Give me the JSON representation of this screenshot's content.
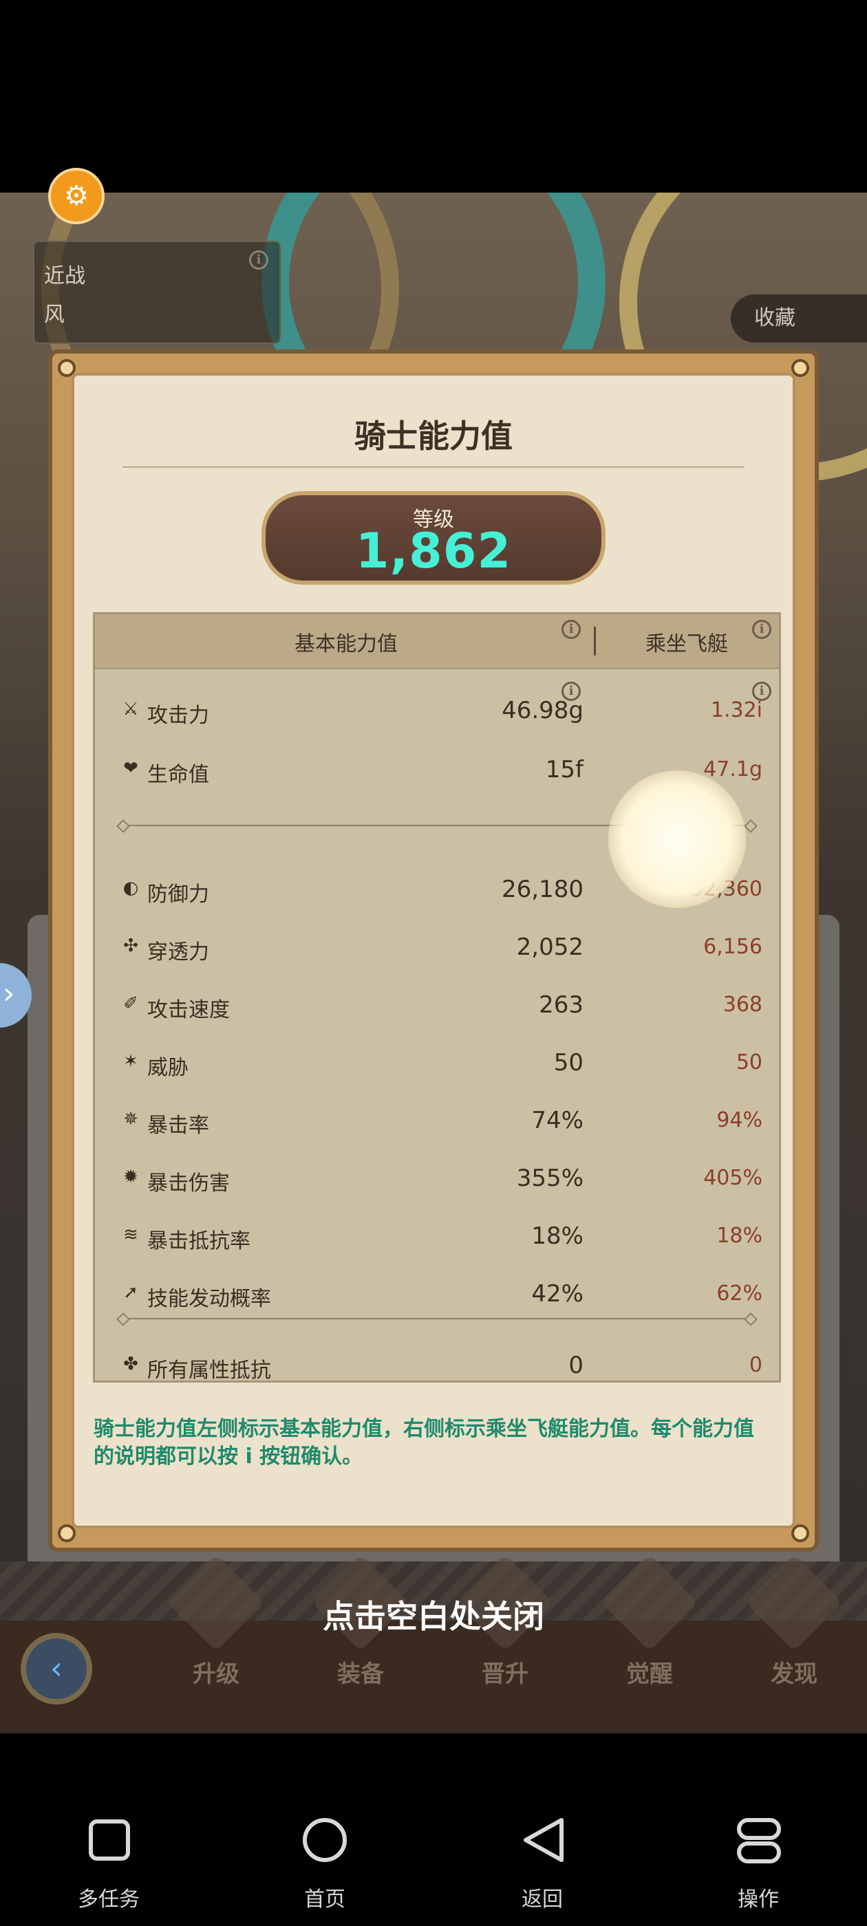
{
  "status": {
    "class_label": "近战",
    "element_label": "风"
  },
  "favorite": {
    "label": "收藏"
  },
  "dialog": {
    "title": "骑士能力值",
    "level": {
      "label": "等级",
      "value": "1,862"
    },
    "columns": {
      "basic": "基本能力值",
      "mount": "乘坐飞艇"
    },
    "group1": [
      {
        "icon": "attack-icon",
        "glyph": "⚔",
        "name": "攻击力",
        "base": "46.98g",
        "mount": "1.32i"
      },
      {
        "icon": "health-icon",
        "glyph": "❤",
        "name": "生命值",
        "base": "15f",
        "mount": "47.1g"
      }
    ],
    "group2": [
      {
        "icon": "defense-icon",
        "glyph": "◐",
        "name": "防御力",
        "base": "26,180",
        "mount": "52,360"
      },
      {
        "icon": "penetration-icon",
        "glyph": "✣",
        "name": "穿透力",
        "base": "2,052",
        "mount": "6,156"
      },
      {
        "icon": "attack-speed-icon",
        "glyph": "✐",
        "name": "攻击速度",
        "base": "263",
        "mount": "368"
      },
      {
        "icon": "threat-icon",
        "glyph": "✶",
        "name": "威胁",
        "base": "50",
        "mount": "50"
      },
      {
        "icon": "crit-rate-icon",
        "glyph": "✵",
        "name": "暴击率",
        "base": "74%",
        "mount": "94%"
      },
      {
        "icon": "crit-damage-icon",
        "glyph": "✹",
        "name": "暴击伤害",
        "base": "355%",
        "mount": "405%"
      },
      {
        "icon": "crit-resist-icon",
        "glyph": "≋",
        "name": "暴击抵抗率",
        "base": "18%",
        "mount": "18%"
      },
      {
        "icon": "skill-chance-icon",
        "glyph": "➚",
        "name": "技能发动概率",
        "base": "42%",
        "mount": "62%"
      }
    ],
    "group3": [
      {
        "icon": "all-resist-icon",
        "glyph": "✤",
        "name": "所有属性抵抗",
        "base": "0",
        "mount": "0"
      }
    ],
    "note": "骑士能力值左侧标示基本能力值，右侧标示乘坐飞艇能力值。每个能力值的说明都可以按 i 按钮确认。"
  },
  "game_nav": {
    "close_hint": "点击空白处关闭",
    "tabs": [
      "升级",
      "装备",
      "晋升",
      "觉醒",
      "发现"
    ]
  },
  "system_nav": {
    "items": [
      {
        "icon": "multitask-icon",
        "label": "多任务"
      },
      {
        "icon": "home-icon",
        "label": "首页"
      },
      {
        "icon": "back-icon",
        "label": "返回"
      },
      {
        "icon": "operations-icon",
        "label": "操作"
      }
    ]
  }
}
